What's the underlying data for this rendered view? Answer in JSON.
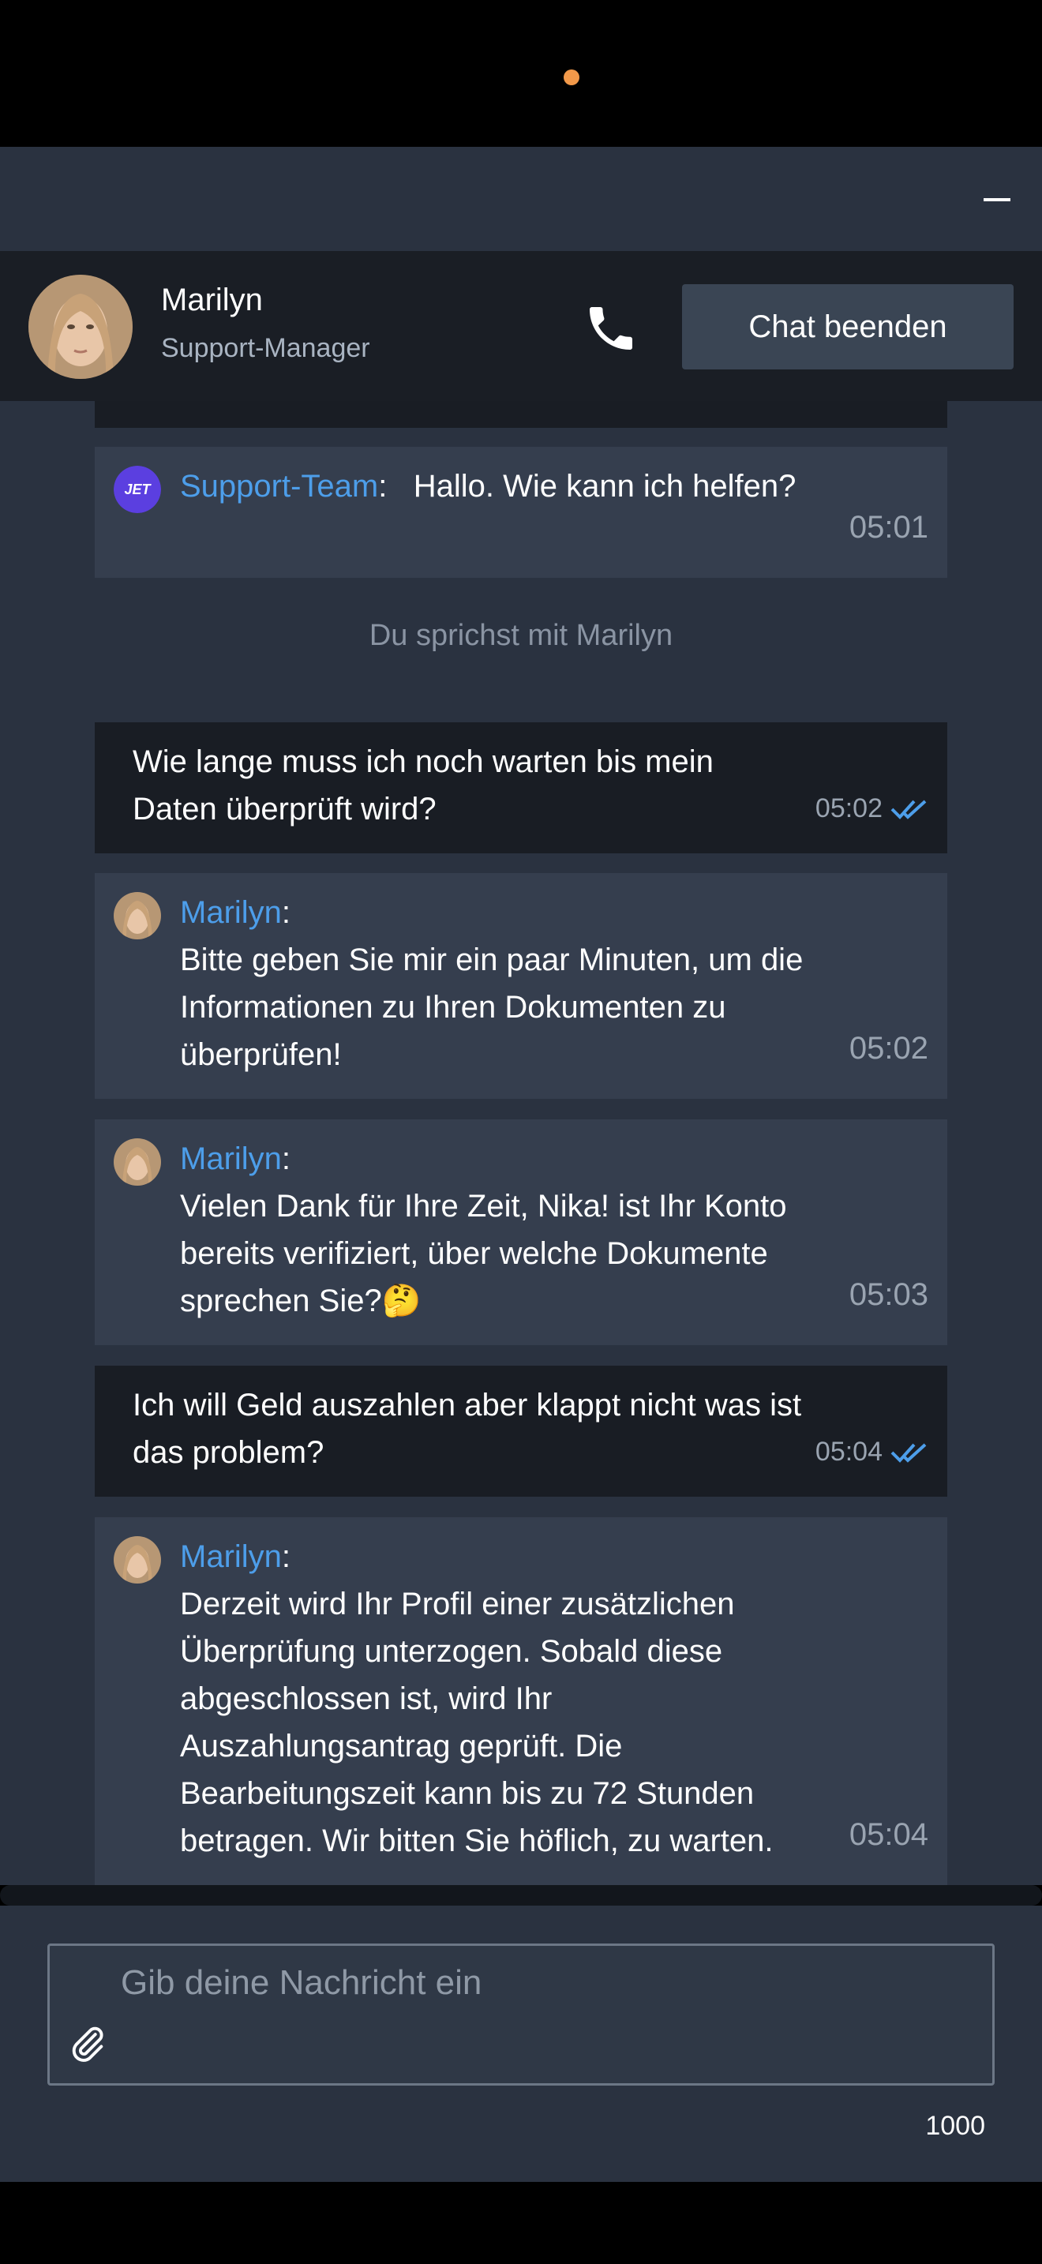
{
  "header": {
    "agent_name": "Marilyn",
    "agent_role": "Support-Manager",
    "end_chat_label": "Chat beenden"
  },
  "messages": [
    {
      "type": "agent",
      "sender": "Support-Team",
      "separator": ":",
      "text": "Hallo. Wie kann ich helfen?",
      "time": "05:01",
      "avatar": "jet-logo-icon"
    },
    {
      "type": "system",
      "text": "Du sprichst mit Marilyn"
    },
    {
      "type": "user",
      "text": "Wie lange muss ich noch warten bis mein Daten überprüft wird?",
      "time": "05:02",
      "status": "read"
    },
    {
      "type": "agent",
      "sender": "Marilyn",
      "separator": ":",
      "text": "Bitte geben Sie mir ein paar Minuten, um die Informationen zu Ihren Dokumenten zu überprüfen!",
      "time": "05:02"
    },
    {
      "type": "agent",
      "sender": "Marilyn",
      "separator": ":",
      "text": "Vielen Dank für Ihre Zeit, Nika! ist Ihr Konto bereits verifiziert, über welche Dokumente sprechen Sie?🤔",
      "time": "05:03"
    },
    {
      "type": "user",
      "text": "Ich will Geld auszahlen aber klappt nicht was ist das problem?",
      "time": "05:04",
      "status": "read"
    },
    {
      "type": "agent",
      "sender": "Marilyn",
      "separator": ":",
      "text": "Derzeit wird Ihr Profil einer zusätzlichen Überprüfung unterzogen. Sobald diese abgeschlossen ist, wird Ihr Auszahlungsantrag geprüft. Die Bearbeitungszeit kann bis zu 72 Stunden betragen. Wir bitten Sie höflich, zu warten.",
      "time": "05:04"
    }
  ],
  "jet_logo_text": "JET",
  "input": {
    "placeholder": "Gib deine Nachricht ein",
    "char_limit": "1000"
  },
  "colors": {
    "accent": "#4d9eea",
    "notch_dot": "#f2994a",
    "jet_logo": "#5b3fe0"
  }
}
